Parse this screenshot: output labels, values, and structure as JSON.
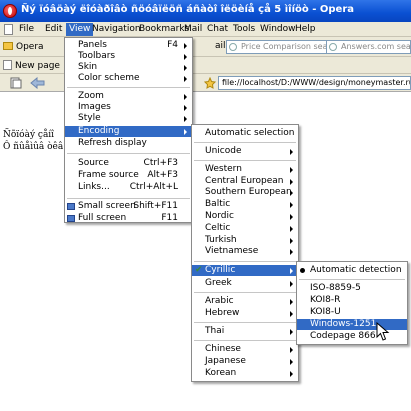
{
  "window": {
    "title": "Ñý ïóâöàý ëîóàðîâò ñöóâïëöñ áñàòî îëöèíå çå 5 ìîíöò - Opera"
  },
  "menubar": {
    "items": [
      "File",
      "Edit",
      "View",
      "Navigation",
      "Bookmarks",
      "Mail",
      "Chat",
      "Tools",
      "Window",
      "Help"
    ]
  },
  "toolbar": {
    "opera_label": "Opera",
    "mail_label": "ail",
    "search1_placeholder": "Price Comparison search",
    "search2_placeholder": "Answers.com search",
    "new_page_label": "New page",
    "address": "file://localhost/D:/WWW/design/moneymaster.ru/ebook"
  },
  "content": {
    "line1": "Ñõïóàý çåíî",
    "line2": "Ô ñûåìûâ òêâ"
  },
  "view_menu": {
    "items": [
      {
        "label": "Panels",
        "shortcut": "F4",
        "submenu": true
      },
      {
        "label": "Toolbars",
        "shortcut": "",
        "submenu": true
      },
      {
        "label": "Skin",
        "shortcut": "",
        "submenu": true
      },
      {
        "label": "Color scheme",
        "shortcut": "",
        "submenu": true
      },
      {
        "label": "Zoom",
        "shortcut": "",
        "submenu": true
      },
      {
        "label": "Images",
        "shortcut": "",
        "submenu": true
      },
      {
        "label": "Style",
        "shortcut": "",
        "submenu": true
      },
      {
        "label": "Encoding",
        "shortcut": "",
        "submenu": true
      },
      {
        "label": "Refresh display",
        "shortcut": "",
        "submenu": false
      },
      {
        "label": "Source",
        "shortcut": "Ctrl+F3",
        "submenu": false
      },
      {
        "label": "Frame source",
        "shortcut": "Alt+F3",
        "submenu": false
      },
      {
        "label": "Links...",
        "shortcut": "Ctrl+Alt+L",
        "submenu": false
      },
      {
        "label": "Small screen",
        "shortcut": "Shift+F11",
        "submenu": false
      },
      {
        "label": "Full screen",
        "shortcut": "F11",
        "submenu": false
      }
    ]
  },
  "encoding_menu": {
    "items": [
      "Automatic selection",
      "Unicode",
      "Western",
      "Central European",
      "Southern European",
      "Baltic",
      "Nordic",
      "Celtic",
      "Turkish",
      "Vietnamese",
      "Cyrillic",
      "Greek",
      "Arabic",
      "Hebrew",
      "Thai",
      "Chinese",
      "Japanese",
      "Korean"
    ]
  },
  "cyrillic_menu": {
    "items": [
      "Automatic detection",
      "ISO-8859-5",
      "KOI8-R",
      "KOI8-U",
      "Windows-1251",
      "Codepage 866"
    ]
  },
  "colors": {
    "titlebar": "#0a50d2",
    "highlight": "#316ac5",
    "chrome": "#ece9d8"
  }
}
